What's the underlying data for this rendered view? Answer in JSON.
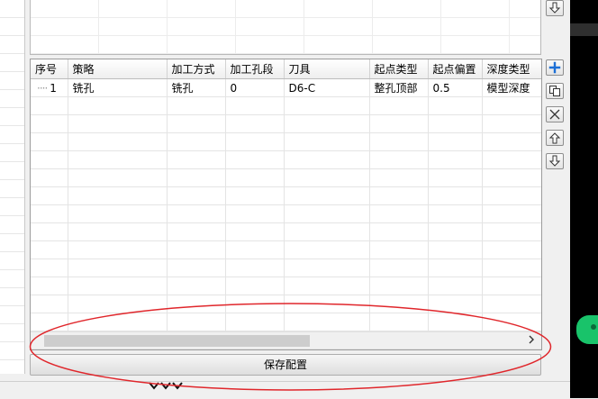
{
  "table": {
    "columns": [
      "序号",
      "策略",
      "加工方式",
      "加工孔段",
      "刀具",
      "起点类型",
      "起点偏置",
      "深度类型"
    ],
    "rows": [
      [
        "1",
        "铣孔",
        "铣孔",
        "0",
        "D6-C",
        "整孔顶部",
        "0.5",
        "模型深度"
      ]
    ]
  },
  "save_button": {
    "label": "保存配置"
  },
  "icons": {
    "scroll_right": "chevron-right-icon",
    "add": "plus-icon",
    "copy": "copy-icon",
    "delete": "x-icon",
    "move_up": "arrow-up-icon",
    "move_down": "arrow-down-icon",
    "top_down": "arrow-down-icon"
  },
  "colors": {
    "annotation": "#e0262b",
    "add_icon": "#1c6fd6",
    "status_green": "#19c36a"
  }
}
